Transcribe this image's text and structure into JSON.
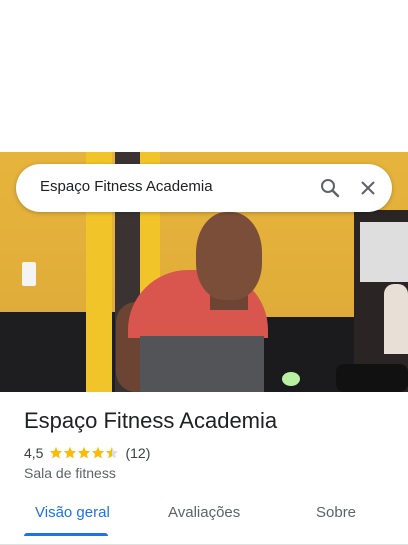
{
  "search": {
    "query": "Espaço Fitness Academia",
    "search_icon": "search-icon",
    "close_icon": "close-icon"
  },
  "place": {
    "name": "Espaço Fitness Academia",
    "rating": "4,5",
    "rating_value": 4.5,
    "review_count": "(12)",
    "category": "Sala de fitness",
    "star_color": "#fbbc04"
  },
  "tabs": [
    {
      "label": "Visão geral",
      "active": true
    },
    {
      "label": "Avaliações",
      "active": false
    },
    {
      "label": "Sobre",
      "active": false
    }
  ],
  "colors": {
    "accent": "#1a73e8"
  }
}
